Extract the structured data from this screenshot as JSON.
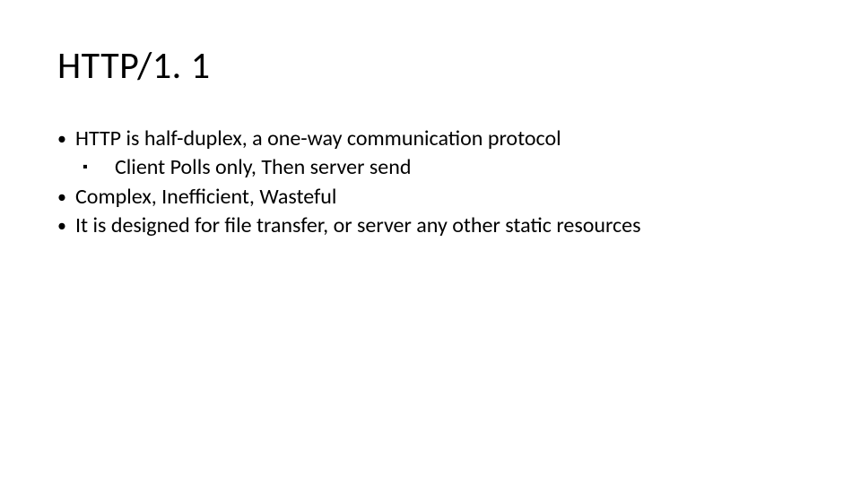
{
  "slide": {
    "title": "HTTP/1. 1",
    "bullets": [
      {
        "level": 1,
        "marker": "•",
        "text": "HTTP is half-duplex, a one-way communication protocol",
        "children": [
          {
            "level": 2,
            "marker": "▪",
            "text": "Client Polls only, Then server send"
          }
        ]
      },
      {
        "level": 1,
        "marker": "•",
        "text": "Complex, Inefficient, Wasteful",
        "children": []
      },
      {
        "level": 1,
        "marker": "•",
        "text": "It is designed for file transfer, or server any other static resources",
        "children": []
      }
    ]
  }
}
